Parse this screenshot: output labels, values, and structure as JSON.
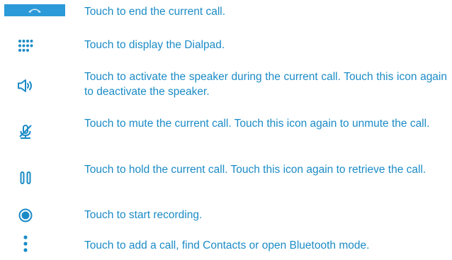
{
  "accent_color": "#1b8bc6",
  "items": [
    {
      "icon": "end-call-icon",
      "text": "Touch to end the current call."
    },
    {
      "icon": "dialpad-icon",
      "text": "Touch to display the Dialpad."
    },
    {
      "icon": "speaker-icon",
      "text": "Touch to activate the speaker during the current call. Touch this icon again to deactivate the speaker."
    },
    {
      "icon": "mute-icon",
      "text": "Touch to mute the current call. Touch this icon again to unmute the call."
    },
    {
      "icon": "hold-icon",
      "text": "Touch to hold the current call. Touch this icon again to retrieve the call."
    },
    {
      "icon": "record-icon",
      "text": "Touch to start recording."
    },
    {
      "icon": "more-options-icon",
      "text": "Touch to add a call, find Contacts or open Bluetooth mode."
    }
  ]
}
